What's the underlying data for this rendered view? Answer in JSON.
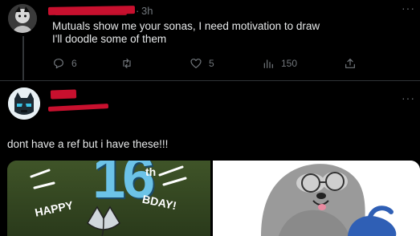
{
  "tweet1": {
    "timestamp": "3h",
    "text_line1": "Mutuals show me your sonas, I need motivation to draw",
    "text_line2": "I'll doodle some of them",
    "actions": {
      "replies": "6",
      "retweets": "",
      "likes": "5",
      "views": "150"
    }
  },
  "tweet2": {
    "text": "dont have a ref but i have these!!!"
  },
  "media": {
    "left_image_text": {
      "big_number": "16",
      "superscript": "th",
      "happy": "HAPPY",
      "bday": "BDAY!"
    }
  },
  "colors": {
    "background": "#000000",
    "text": "#e7e9ea",
    "muted": "#71767b",
    "redaction": "#c8102e",
    "divider": "#2f3336"
  }
}
